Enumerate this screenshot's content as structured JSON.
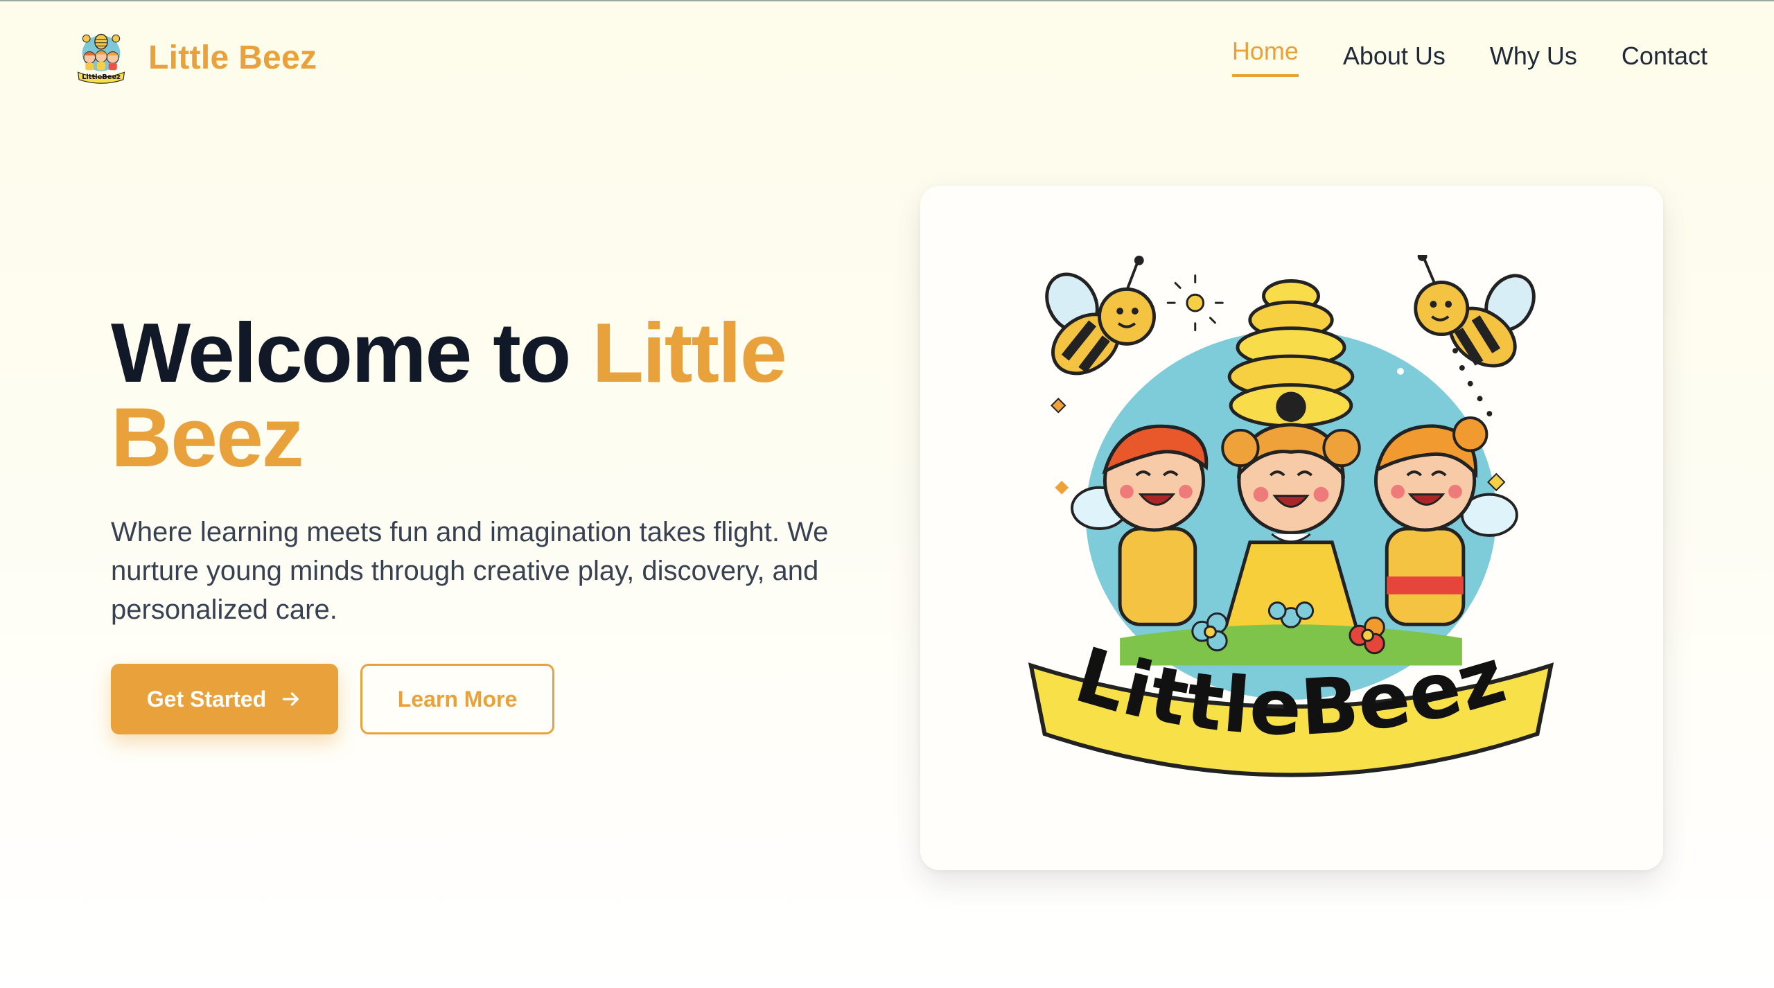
{
  "brand": {
    "name": "Little Beez",
    "logo_text": "LittleBeez"
  },
  "nav": {
    "items": [
      {
        "label": "Home",
        "active": true
      },
      {
        "label": "About Us",
        "active": false
      },
      {
        "label": "Why Us",
        "active": false
      },
      {
        "label": "Contact",
        "active": false
      }
    ]
  },
  "hero": {
    "title_prefix": "Welcome to ",
    "title_accent": "Little Beez",
    "description": "Where learning meets fun and imagination takes flight. We nurture young minds through creative play, discovery, and personalized care.",
    "primary_button": {
      "label": "Get Started",
      "icon": "arrow-right-icon"
    },
    "secondary_button": {
      "label": "Learn More"
    }
  },
  "image": {
    "logo_text": "LittleBeez"
  },
  "colors": {
    "accent": "#e9a23b",
    "text": "#111827",
    "body_text": "#374151",
    "background": "#fefcea"
  }
}
